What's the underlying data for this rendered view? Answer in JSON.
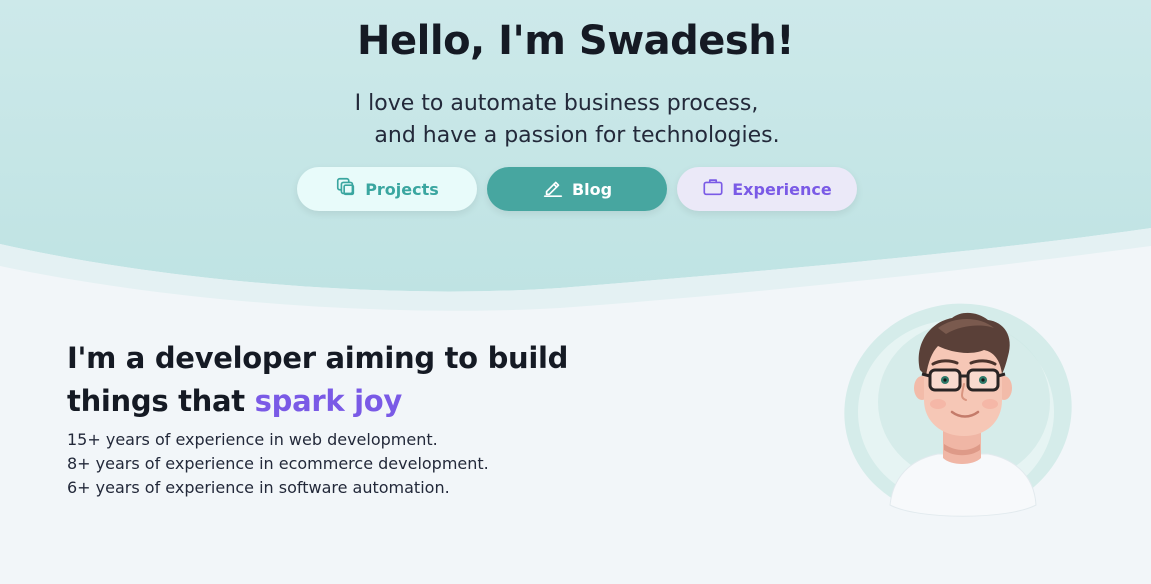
{
  "hero": {
    "title": "Hello, I'm Swadesh!",
    "tagline_line1": "I love to automate business process,",
    "tagline_line2": "and have a passion for technologies."
  },
  "buttons": {
    "projects": {
      "label": "Projects",
      "icon": "copy-icon"
    },
    "blog": {
      "label": "Blog",
      "icon": "pencil-icon"
    },
    "experience": {
      "label": "Experience",
      "icon": "briefcase-icon"
    }
  },
  "intro": {
    "heading_line1": "I'm a developer aiming to build",
    "heading_line2_prefix": "things that ",
    "heading_highlight": "spark joy",
    "facts": [
      "15+ years of experience in web development.",
      "8+ years of experience in ecommerce development.",
      "6+ years of experience in software automation."
    ]
  },
  "colors": {
    "hero_teal": "#c4e6e6",
    "accent_teal": "#47a6a0",
    "accent_purple": "#7a5ae6",
    "page_bg": "#f2f6f9"
  }
}
